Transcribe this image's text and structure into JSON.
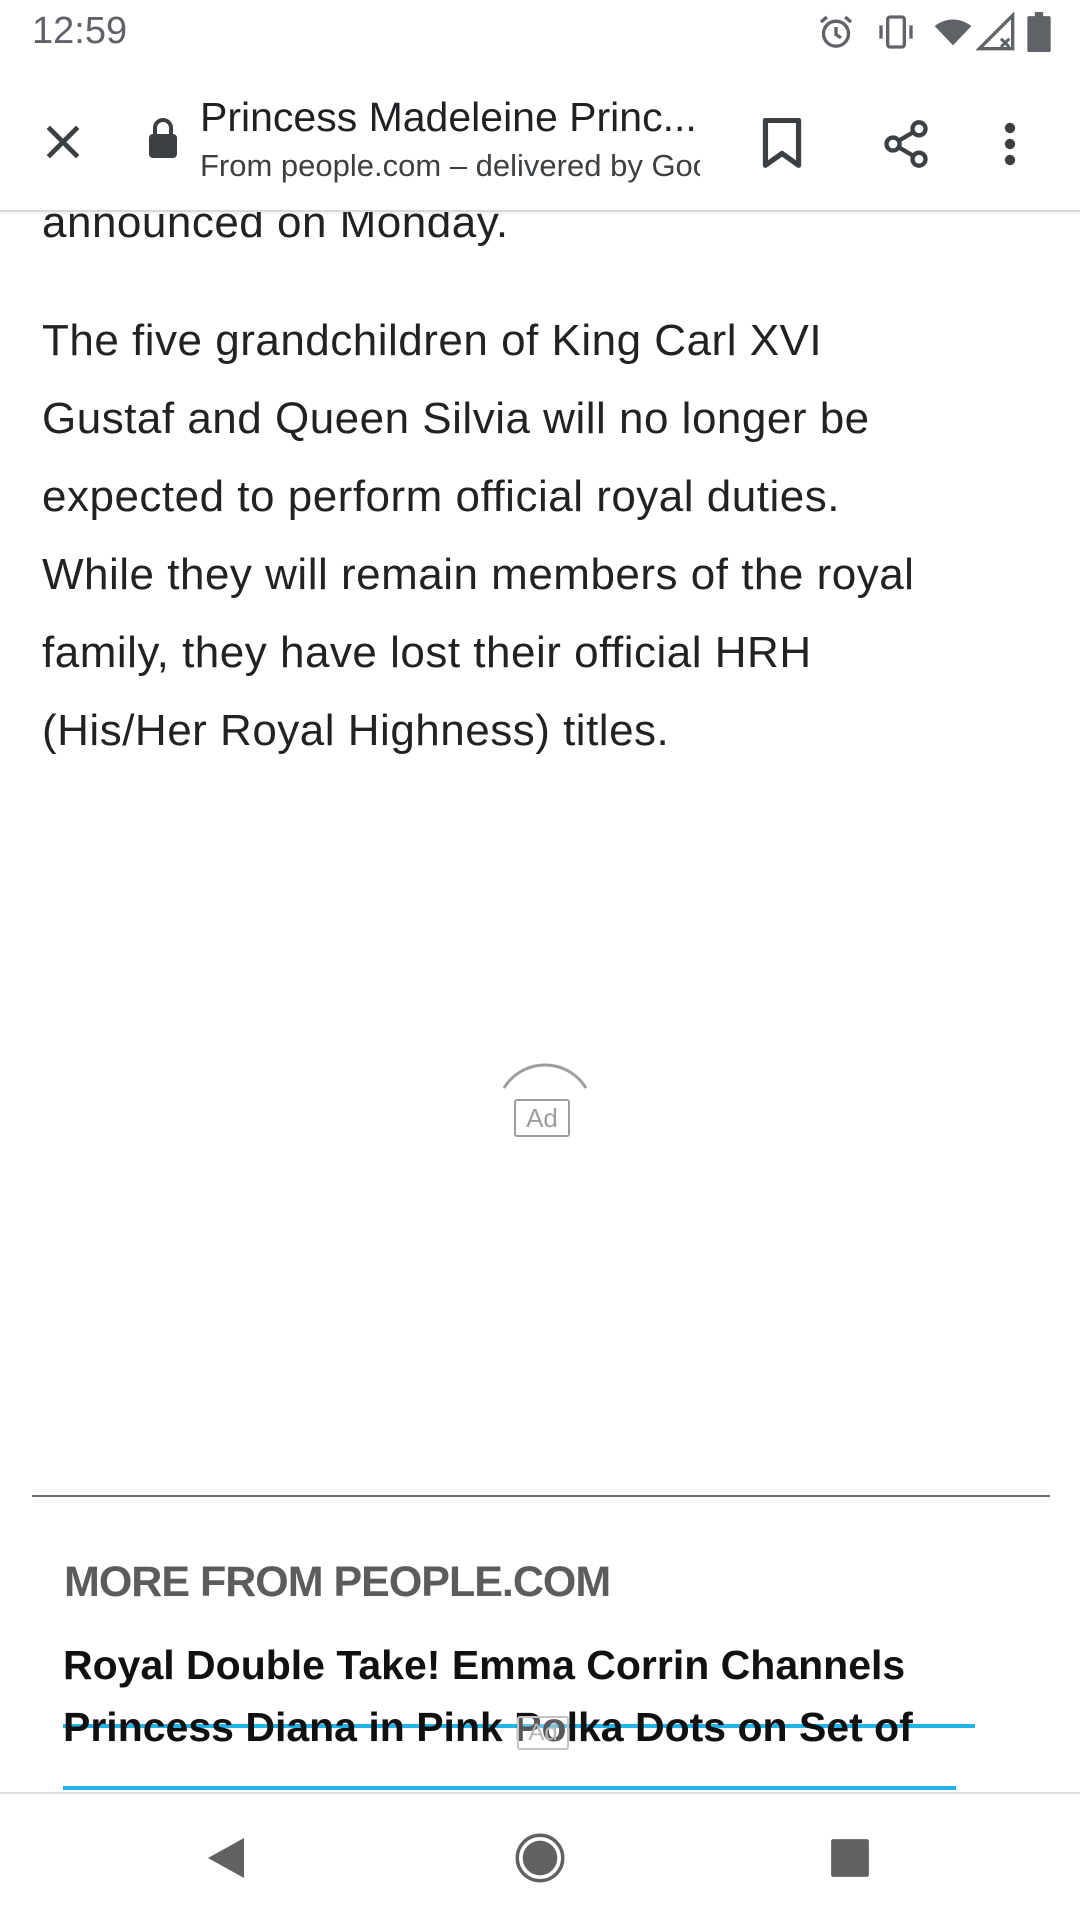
{
  "status_bar": {
    "time": "12:59",
    "icons": [
      "alarm-icon",
      "vibrate-icon",
      "wifi-icon",
      "signal-icon",
      "battery-icon"
    ]
  },
  "toolbar": {
    "title": "Princess Madeleine Princ...",
    "subtitle": "From people.com – delivered by Goo",
    "icons": [
      "close-icon",
      "lock-icon",
      "bookmark-icon",
      "share-icon",
      "more-vert-icon"
    ]
  },
  "article": {
    "previous_line": "announced on Monday.",
    "paragraph_lines": [
      "The five grandchildren of King Carl XVI",
      "Gustaf and Queen Silvia will no longer be",
      "expected to perform official royal duties.",
      "While they will remain members of the royal",
      "family, they have lost their official HRH",
      "(His/Her Royal Highness) titles."
    ],
    "ad_label": "Ad"
  },
  "more_from": {
    "heading": "MORE FROM PEOPLE.COM",
    "headline_lines": [
      "Royal Double Take! Emma Corrin Channels",
      "Princess Diana in Pink Polka Dots on Set of"
    ],
    "ad_label": "Ad"
  },
  "nav_bar": {
    "icons": [
      "back-icon",
      "home-icon",
      "recents-icon"
    ]
  },
  "colors": {
    "link_underline": "#22b3ea",
    "icon_gray": "#5f6368",
    "heading_gray": "#5c5c5c"
  }
}
